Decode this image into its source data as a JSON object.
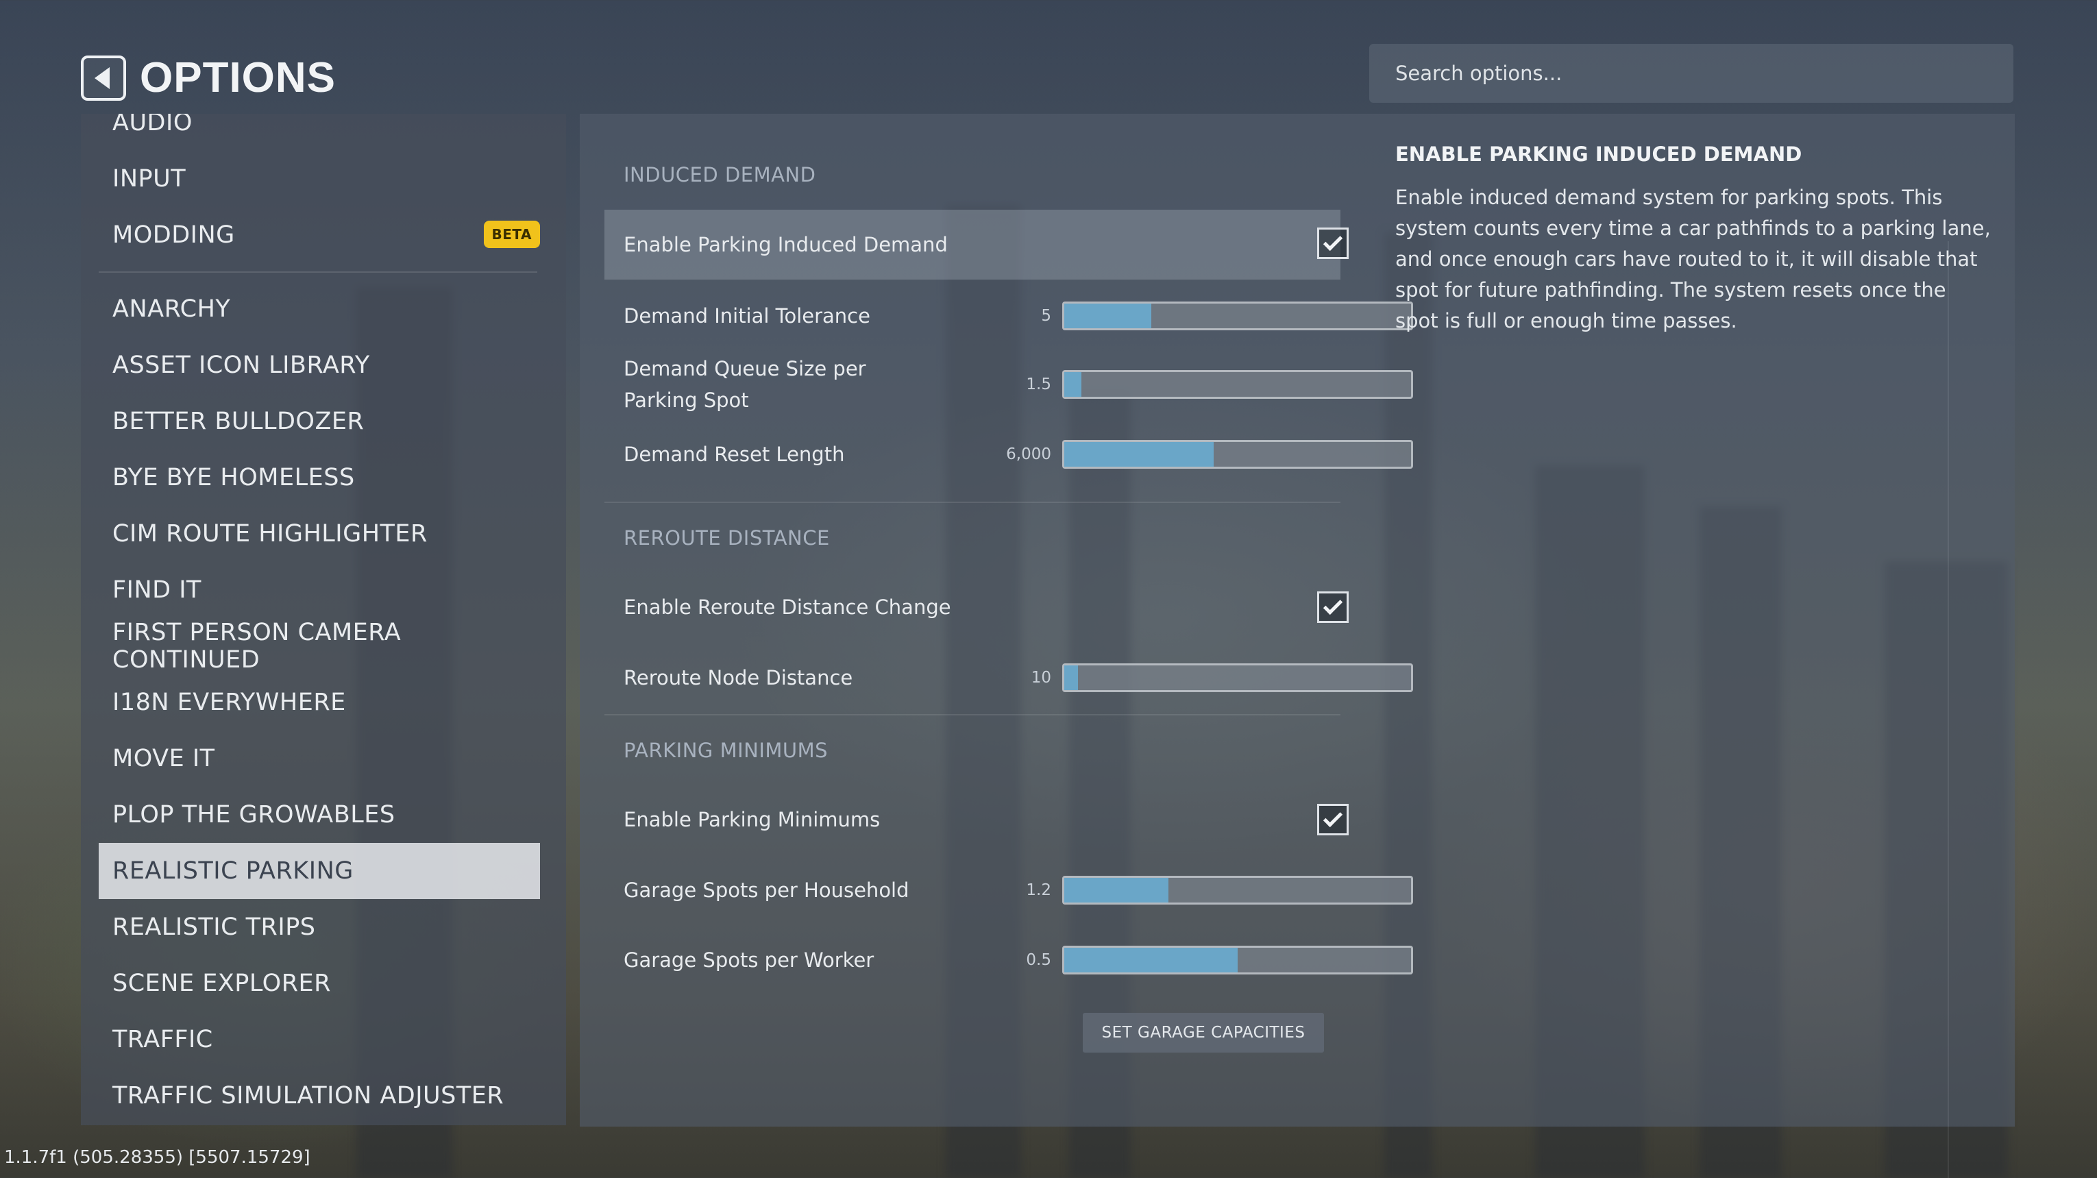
{
  "header": {
    "title": "OPTIONS"
  },
  "search": {
    "placeholder": "Search options..."
  },
  "sidebar": {
    "items_top": [
      {
        "label": "AUDIO"
      },
      {
        "label": "INPUT"
      },
      {
        "label": "MODDING",
        "badge": "BETA"
      }
    ],
    "items": [
      {
        "label": "ANARCHY"
      },
      {
        "label": "ASSET ICON LIBRARY"
      },
      {
        "label": "BETTER BULLDOZER"
      },
      {
        "label": "BYE BYE HOMELESS"
      },
      {
        "label": "CIM ROUTE HIGHLIGHTER"
      },
      {
        "label": "FIND IT"
      },
      {
        "label": "FIRST PERSON CAMERA CONTINUED"
      },
      {
        "label": "I18N EVERYWHERE"
      },
      {
        "label": "MOVE IT"
      },
      {
        "label": "PLOP THE GROWABLES"
      },
      {
        "label": "REALISTIC PARKING",
        "selected": true
      },
      {
        "label": "REALISTIC TRIPS"
      },
      {
        "label": "SCENE EXPLORER"
      },
      {
        "label": "TRAFFIC"
      },
      {
        "label": "TRAFFIC SIMULATION ADJUSTER"
      }
    ]
  },
  "settings": {
    "induced_demand": {
      "heading": "INDUCED DEMAND",
      "enable_label": "Enable Parking Induced Demand",
      "enable_checked": true,
      "tolerance_label": "Demand Initial Tolerance",
      "tolerance_value": "5",
      "tolerance_fraction": 0.25,
      "queue_label": "Demand Queue Size per Parking Spot",
      "queue_value": "1.5",
      "queue_fraction": 0.05,
      "reset_label": "Demand Reset Length",
      "reset_value": "6,000",
      "reset_fraction": 0.43
    },
    "reroute": {
      "heading": "REROUTE DISTANCE",
      "enable_label": "Enable Reroute Distance Change",
      "enable_checked": true,
      "node_label": "Reroute Node Distance",
      "node_value": "10",
      "node_fraction": 0.04
    },
    "minimums": {
      "heading": "PARKING MINIMUMS",
      "enable_label": "Enable Parking Minimums",
      "enable_checked": true,
      "household_label": "Garage Spots per Household",
      "household_value": "1.2",
      "household_fraction": 0.3,
      "worker_label": "Garage Spots per Worker",
      "worker_value": "0.5",
      "worker_fraction": 0.5,
      "button_label": "SET GARAGE CAPACITIES"
    }
  },
  "info": {
    "title": "ENABLE PARKING INDUCED DEMAND",
    "body": "Enable induced demand system for parking spots. This system counts every time a car pathfinds to a parking lane, and once enough cars have routed to it, it will disable that spot for future pathfinding. The system resets once the spot is full or enough time passes."
  },
  "version": "1.1.7f1 (505.28355) [5507.15729]",
  "colors": {
    "accent": "#6aa6c8",
    "beta_badge": "#f1c21b"
  },
  "icons": {
    "back": "back-arrow-icon",
    "check": "checkmark-icon"
  }
}
